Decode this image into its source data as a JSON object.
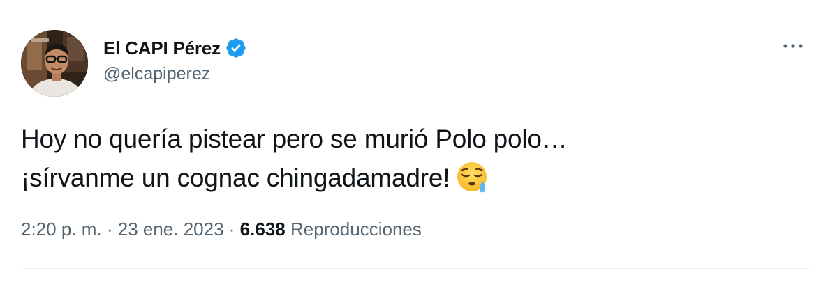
{
  "author": {
    "display_name": "El CAPI Pérez",
    "handle": "@elcapiperez",
    "verified": true,
    "avatar_icon": "profile-photo",
    "verified_icon": "verified-badge-icon",
    "verified_color": "#1d9bf0"
  },
  "menu": {
    "icon": "more-options-icon"
  },
  "tweet": {
    "line1": "Hoy no quería pistear pero se murió Polo polo…",
    "line2": "¡sírvanme un cognac chingadamadre!",
    "emoji": "sleepy-face-emoji"
  },
  "meta": {
    "time": "2:20 p. m.",
    "separator1": " · ",
    "date": "23 ene. 2023",
    "separator2": " · ",
    "views_count": "6.638",
    "views_label": "Reproducciones"
  },
  "colors": {
    "text_primary": "#0f1419",
    "text_secondary": "#536471",
    "divider": "#eff3f4"
  }
}
